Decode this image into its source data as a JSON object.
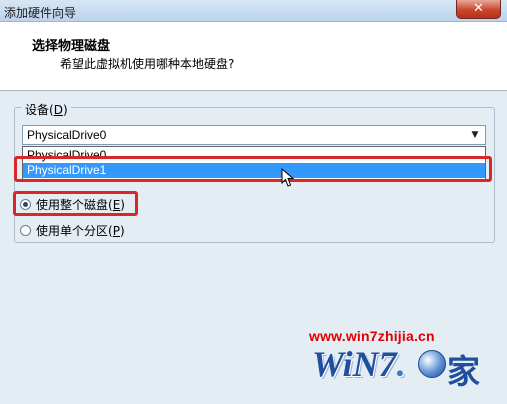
{
  "window": {
    "title": "添加硬件向导",
    "close_glyph": "✕"
  },
  "header": {
    "title": "选择物理磁盘",
    "subtitle": "希望此虚拟机使用哪种本地硬盘?"
  },
  "device": {
    "label_prefix": "设备(",
    "label_key": "D",
    "label_suffix": ")",
    "selected": "PhysicalDrive0",
    "options": [
      "PhysicalDrive0",
      "PhysicalDrive1"
    ],
    "highlighted_index": 1
  },
  "usage": {
    "options": [
      {
        "prefix": "使用整个磁盘(",
        "key": "E",
        "suffix": ")",
        "checked": true
      },
      {
        "prefix": "使用单个分区(",
        "key": "P",
        "suffix": ")",
        "checked": false
      }
    ]
  },
  "watermark": {
    "url": "www.win7zhijia.cn",
    "logo": "WiN7",
    "logo_dot": ".",
    "logo_char": "家"
  },
  "colors": {
    "highlight": "#d62828",
    "selection": "#3399ff",
    "watermark_red": "#e00000",
    "watermark_blue": "#1f4f9e"
  }
}
